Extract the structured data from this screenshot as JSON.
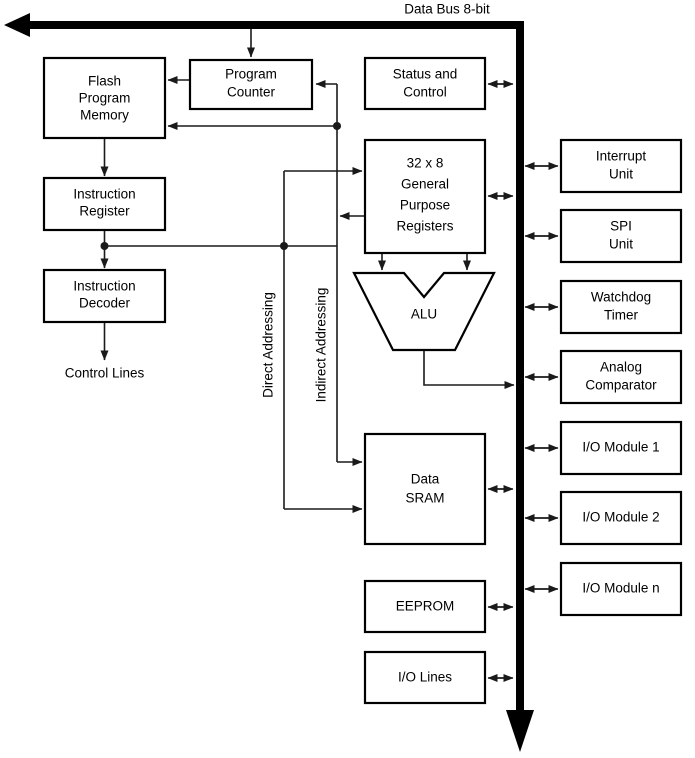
{
  "diagram": {
    "title": "Data Bus 8-bit",
    "bus": {
      "label": "Data Bus 8-bit",
      "width_bits": "8-bit",
      "color": "#000000",
      "top_arrow_direction": "left",
      "bottom_arrow_direction": "down"
    },
    "blocks": {
      "flash_program_memory": "Flash\nProgram\nMemory",
      "flash_program_memory_lines": [
        "Flash",
        "Program",
        "Memory"
      ],
      "program_counter_lines": [
        "Program",
        "Counter"
      ],
      "status_and_control_lines": [
        "Status and",
        "Control"
      ],
      "instruction_register_lines": [
        "Instruction",
        "Register"
      ],
      "instruction_decoder_lines": [
        "Instruction",
        "Decoder"
      ],
      "general_purpose_registers_lines": [
        "32 x 8",
        "General",
        "Purpose",
        "Registers"
      ],
      "alu_label": "ALU",
      "data_sram_lines": [
        "Data",
        "SRAM"
      ],
      "eeprom_label": "EEPROM",
      "io_lines_label": "I/O Lines",
      "interrupt_unit_lines": [
        "Interrupt",
        "Unit"
      ],
      "spi_unit_lines": [
        "SPI",
        "Unit"
      ],
      "watchdog_timer_lines": [
        "Watchdog",
        "Timer"
      ],
      "analog_comparator_lines": [
        "Analog",
        "Comparator"
      ],
      "io_module_1": "I/O Module 1",
      "io_module_2": "I/O Module 2",
      "io_module_n": "I/O Module n"
    },
    "annotations": {
      "control_lines": "Control Lines",
      "direct_addressing": "Direct Addressing",
      "indirect_addressing": "Indirect Addressing"
    }
  }
}
